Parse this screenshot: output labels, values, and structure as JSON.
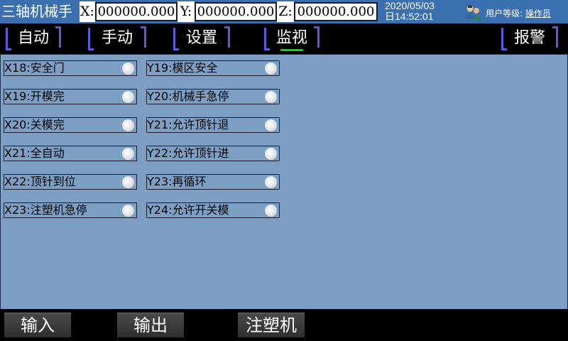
{
  "header": {
    "app_title": "三轴机械手",
    "coords": [
      {
        "label": "X:",
        "value": "000000.000"
      },
      {
        "label": "Y:",
        "value": "000000.000"
      },
      {
        "label": "Z:",
        "value": "000000.000"
      }
    ],
    "date": "2020/05/03",
    "time": "日14:52:01",
    "user_level_label": "用户等级:",
    "user_name": "操作员"
  },
  "nav": {
    "tabs": [
      {
        "label": "自动",
        "active": false
      },
      {
        "label": "手动",
        "active": false
      },
      {
        "label": "设置",
        "active": false
      },
      {
        "label": "监视",
        "active": true
      },
      {
        "label": "报警",
        "active": false
      }
    ]
  },
  "inputs": [
    {
      "label": "X18:安全门",
      "on": false
    },
    {
      "label": "X19:开模完",
      "on": false
    },
    {
      "label": "X20:关模完",
      "on": false
    },
    {
      "label": "X21:全自动",
      "on": false
    },
    {
      "label": "X22:顶针到位",
      "on": false
    },
    {
      "label": "X23:注塑机急停",
      "on": false
    }
  ],
  "outputs": [
    {
      "label": "Y19:模区安全",
      "on": false
    },
    {
      "label": "Y20:机械手急停",
      "on": false
    },
    {
      "label": "Y21:允许顶针退",
      "on": false
    },
    {
      "label": "Y22:允许顶针进",
      "on": false
    },
    {
      "label": "Y23:再循环",
      "on": false
    },
    {
      "label": "Y24:允许开关模",
      "on": false
    }
  ],
  "bottom": {
    "buttons": [
      "输入",
      "输出",
      "注塑机"
    ]
  },
  "colors": {
    "header_bg": "#3a6fb0",
    "panel_bg": "#7e9fc4",
    "tab_bracket": "#5a5ae0",
    "active_indicator": "#00e000",
    "led_off": "#e0e4e8"
  }
}
